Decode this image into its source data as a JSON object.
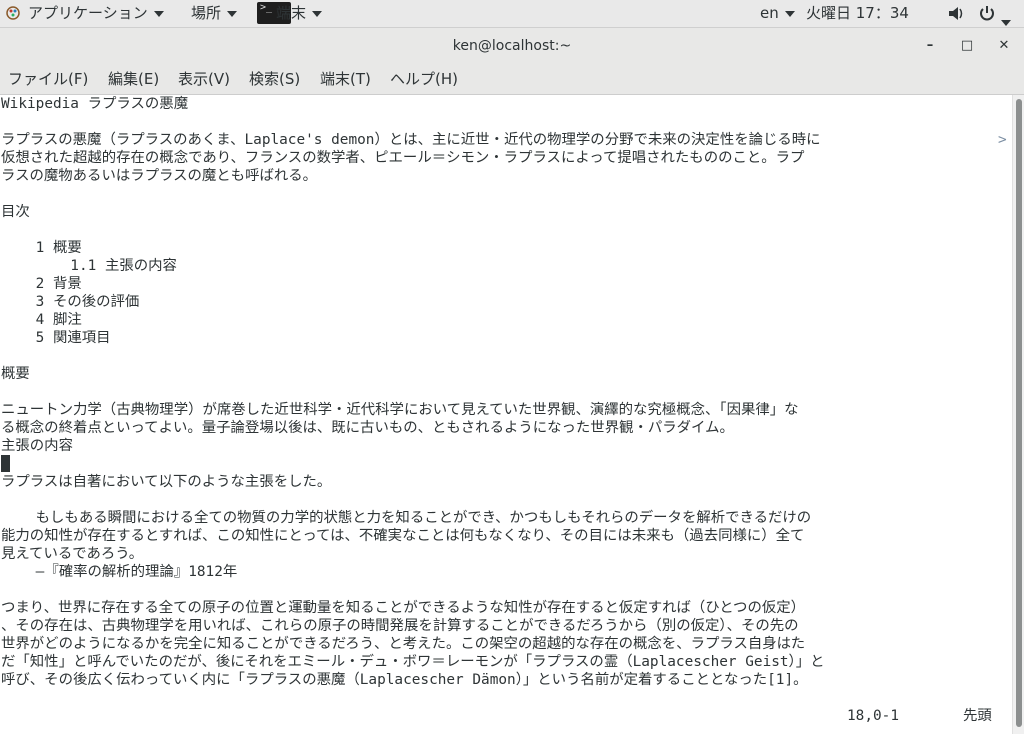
{
  "panel": {
    "applications": "アプリケーション",
    "places": "場所",
    "app": "端末",
    "terminal_icon_text": ">_",
    "lang": "en",
    "clock": "火曜日 17：34"
  },
  "window": {
    "title": "ken@localhost:~",
    "minimize": "–",
    "maximize": "□",
    "close": "✕"
  },
  "menu": [
    "ファイル(F)",
    "編集(E)",
    "表示(V)",
    "検索(S)",
    "端末(T)",
    "ヘルプ(H)"
  ],
  "terminal": {
    "lines": [
      "Wikipedia ラプラスの悪魔",
      "",
      "ラプラスの悪魔（ラプラスのあくま、Laplace's demon）とは、主に近世・近代の物理学の分野で未来の決定性を論じる時に",
      "仮想された超越的存在の概念であり、フランスの数学者、ピエール＝シモン・ラプラスによって提唱されたもののこと。ラプ",
      "ラスの魔物あるいはラプラスの魔とも呼ばれる。",
      "",
      "目次",
      "",
      "    1 概要",
      "        1.1 主張の内容",
      "    2 背景",
      "    3 その後の評価",
      "    4 脚注",
      "    5 関連項目",
      "",
      "概要",
      "",
      "ニュートン力学（古典物理学）が席巻した近世科学・近代科学において見えていた世界観、演繹的な究極概念、「因果律」な",
      "る概念の終着点といってよい。量子論登場以後は、既に古いもの、ともされるようになった世界観・パラダイム。",
      "主張の内容",
      "",
      "ラプラスは自著において以下のような主張をした。",
      "",
      "    もしもある瞬間における全ての物質の力学的状態と力を知ることができ、かつもしもそれらのデータを解析できるだけの",
      "能力の知性が存在するとすれば、この知性にとっては、不確実なことは何もなくなり、その目には未来も（過去同様に）全て",
      "見えているであろう。",
      "    —『確率の解析的理論』1812年",
      "",
      "つまり、世界に存在する全ての原子の位置と運動量を知ることができるような知性が存在すると仮定すれば（ひとつの仮定）",
      "、その存在は、古典物理学を用いれば、これらの原子の時間発展を計算することができるだろうから（別の仮定）、その先の",
      "世界がどのようになるかを完全に知ることができるだろう、と考えた。この架空の超越的な存在の概念を、ラプラス自身はた",
      "だ「知性」と呼んでいたのだが、後にそれをエミール・デュ・ボワ＝レーモンが「ラプラスの霊（Laplacescher Geist）」と",
      "呼び、その後広く伝わっていく内に「ラプラスの悪魔（Laplacescher Dämon）」という名前が定着することとなった[1]。"
    ],
    "truncation_marker": ">",
    "status_position": "18,0-1",
    "status_scroll": "先頭"
  }
}
